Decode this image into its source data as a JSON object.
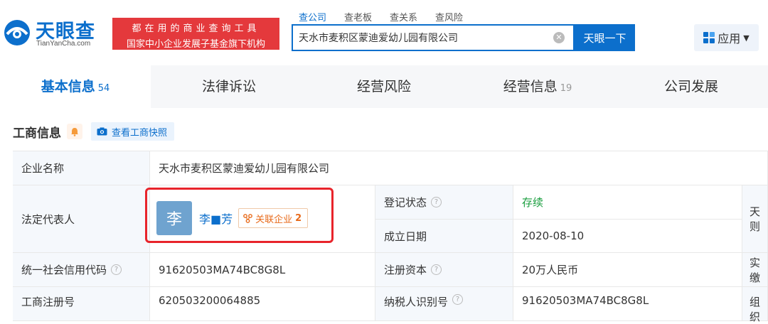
{
  "logo": {
    "name": "天眼查",
    "url": "TianYanCha.com"
  },
  "slogan": {
    "line1": "都在用的商业查询工具",
    "line2": "国家中小企业发展子基金旗下机构"
  },
  "search": {
    "tabs": [
      "查公司",
      "查老板",
      "查关系",
      "查风险"
    ],
    "active_tab": "查公司",
    "value": "天水市麦积区蒙迪爱幼儿园有限公司",
    "button": "天眼一下"
  },
  "app_menu": {
    "label": "应用"
  },
  "nav": {
    "tabs": [
      {
        "label": "基本信息",
        "count": "54"
      },
      {
        "label": "法律诉讼",
        "count": ""
      },
      {
        "label": "经营风险",
        "count": ""
      },
      {
        "label": "经营信息",
        "count": "19"
      },
      {
        "label": "公司发展",
        "count": ""
      }
    ]
  },
  "section": {
    "title": "工商信息",
    "snapshot_label": "查看工商快照"
  },
  "info": {
    "company_name_label": "企业名称",
    "company_name": "天水市麦积区蒙迪爱幼儿园有限公司",
    "legal_rep_label": "法定代表人",
    "legal_rep_avatar": "李",
    "legal_rep_name": "李■芳",
    "related_label": "关联企业",
    "related_count": "2",
    "reg_status_label": "登记状态",
    "reg_status": "存续",
    "found_date_label": "成立日期",
    "found_date": "2020-08-10",
    "credit_code_label": "统一社会信用代码",
    "credit_code": "91620503MA74BC8G8L",
    "reg_capital_label": "注册资本",
    "reg_capital": "20万人民币",
    "reg_no_label": "工商注册号",
    "reg_no": "620503200064885",
    "taxpayer_label": "纳税人识别号",
    "taxpayer_no": "91620503MA74BC8G8L",
    "right_col_1": "天则",
    "right_col_2": "实缴",
    "right_col_3": "组织"
  },
  "colors": {
    "brand": "#0c6fcc",
    "slogan_bg": "#e4393c",
    "status_green": "#1a9e3f",
    "highlight": "#e8242b"
  }
}
